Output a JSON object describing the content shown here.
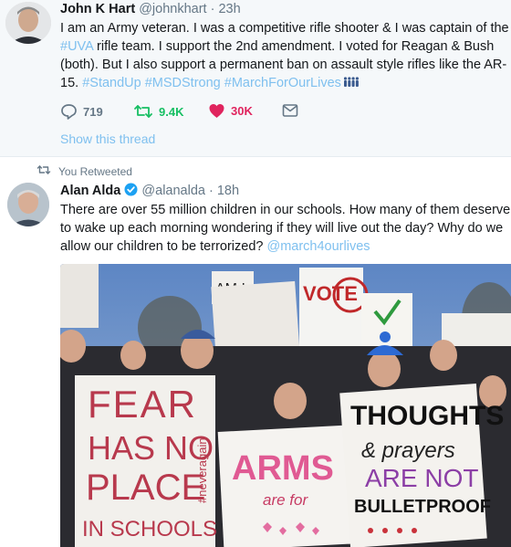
{
  "tweet1": {
    "name": "John K Hart",
    "handle": "@johnkhart",
    "time": "· 23h",
    "text_a": "I am an Army veteran. I was a competitive rifle shooter & I was captain of the ",
    "hashtag_uva": "#UVA",
    "text_b": " rifle team. I support the 2nd amendment. I voted for Reagan & Bush (both). But I also support a permanent ban on assault style rifles like the AR-15.",
    "hashtags": "#StandUp #MSDStrong #MarchForOurLives",
    "replies": "719",
    "retweets": "9.4K",
    "likes": "30K",
    "show_thread": "Show this thread"
  },
  "retweet_label": "You Retweeted",
  "tweet2": {
    "name": "Alan Alda",
    "handle": "@alanalda",
    "time": "· 18h",
    "text": "There are over 55 million children in our schools. How many of them deserve to wake up each morning wondering if they will live out the day? Why do we allow our children to be terrorized? ",
    "mention": "@march4ourlives"
  },
  "photo_signs": {
    "sign1": [
      "FEAR",
      "HAS NO",
      "PLACE",
      "IN SCHOOLS"
    ],
    "sign2": [
      "ARMS",
      "are for"
    ],
    "sign3": [
      "THOUGHTS",
      "& prayers",
      "ARE NOT",
      "BULLETPROOF"
    ],
    "sign_small_1": "AM I",
    "sign_small_2": "VOTE",
    "side_text": "#neveragain"
  },
  "colors": {
    "link": "#7fc0ef",
    "retweet_green": "#17bf63",
    "like_red": "#e0245e",
    "muted": "#657786",
    "tweet1_bg": "#f5f8fa"
  },
  "icons": [
    "reply-icon",
    "retweet-icon",
    "heart-icon",
    "mail-icon",
    "retweeted-icon",
    "people-emoji-icon"
  ]
}
